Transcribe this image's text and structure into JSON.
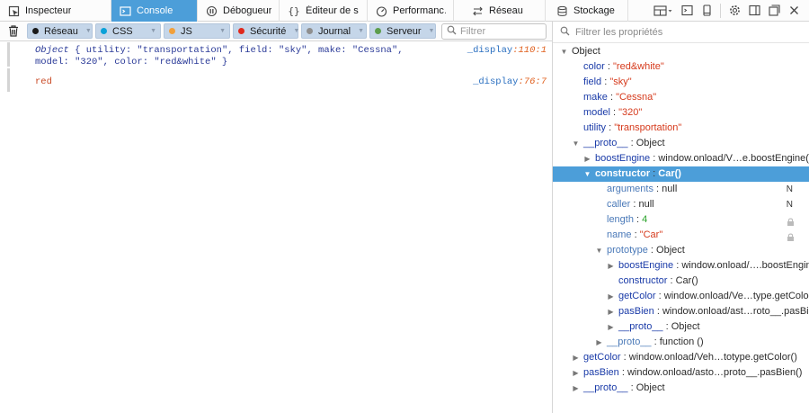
{
  "toolbar": {
    "tabs": [
      {
        "label": "Inspecteur",
        "icon": "inspector-icon"
      },
      {
        "label": "Console",
        "icon": "console-icon"
      },
      {
        "label": "Débogueur",
        "icon": "debugger-icon"
      },
      {
        "label": "Éditeur de s…",
        "icon": "style-editor-icon"
      },
      {
        "label": "Performanc…",
        "icon": "performance-icon"
      },
      {
        "label": "Réseau",
        "icon": "network-icon"
      },
      {
        "label": "Stockage",
        "icon": "storage-icon"
      }
    ],
    "selected_tab": "Console",
    "right_icons": [
      "layout-dock-icon",
      "split-console-icon",
      "responsive-mode-icon",
      "settings-gear-icon",
      "dock-side-icon",
      "dock-window-icon",
      "close-icon"
    ]
  },
  "filterbar": {
    "clear_icon": "trash-icon",
    "filters": [
      {
        "label": "Réseau",
        "color": "#1a1a1a"
      },
      {
        "label": "CSS",
        "color": "#0aa1d8"
      },
      {
        "label": "JS",
        "color": "#f2a03a"
      },
      {
        "label": "Sécurité",
        "color": "#e0281c"
      },
      {
        "label": "Journal",
        "color": "#8f8f8f"
      },
      {
        "label": "Serveur",
        "color": "#5c9d4c"
      }
    ],
    "search_placeholder": "Filtrer"
  },
  "console": {
    "messages": [
      {
        "object_keyword": "Object",
        "text": " { utility: \"transportation\", field: \"sky\", make: \"Cessna\", model: \"320\", color: \"red&white\" }",
        "source": "_display",
        "line": ":110:1"
      },
      {
        "text": "red",
        "source": "_display",
        "line": ":76:7"
      }
    ]
  },
  "sidebar": {
    "search_placeholder": "Filtrer les propriétés",
    "rows": [
      {
        "indent": 0,
        "twisty": "open",
        "name": "Object",
        "name_style": "plain",
        "sep": "",
        "value": "",
        "value_style": ""
      },
      {
        "indent": 1,
        "twisty": "none",
        "name": "color",
        "name_style": "prop",
        "sep": " : ",
        "value": "\"red&white\"",
        "value_style": "str"
      },
      {
        "indent": 1,
        "twisty": "none",
        "name": "field",
        "name_style": "prop",
        "sep": " : ",
        "value": "\"sky\"",
        "value_style": "str"
      },
      {
        "indent": 1,
        "twisty": "none",
        "name": "make",
        "name_style": "prop",
        "sep": " : ",
        "value": "\"Cessna\"",
        "value_style": "str"
      },
      {
        "indent": 1,
        "twisty": "none",
        "name": "model",
        "name_style": "prop",
        "sep": " : ",
        "value": "\"320\"",
        "value_style": "str"
      },
      {
        "indent": 1,
        "twisty": "none",
        "name": "utility",
        "name_style": "prop",
        "sep": " : ",
        "value": "\"transportation\"",
        "value_style": "str"
      },
      {
        "indent": 1,
        "twisty": "open",
        "name": "__proto__",
        "name_style": "prop",
        "sep": " : ",
        "value": "Object",
        "value_style": "plain"
      },
      {
        "indent": 2,
        "twisty": "closed",
        "name": "boostEngine",
        "name_style": "prop",
        "sep": " : ",
        "value": "window.onload/V…e.boostEngine()",
        "value_style": "plain"
      },
      {
        "indent": 2,
        "twisty": "open",
        "name": "constructor",
        "name_style": "prop",
        "sep": " : ",
        "value": "Car()",
        "value_style": "plain",
        "selected": true
      },
      {
        "indent": 3,
        "twisty": "none",
        "name": "arguments",
        "name_style": "dim",
        "sep": " : ",
        "value": "null",
        "value_style": "plain",
        "flag": "N"
      },
      {
        "indent": 3,
        "twisty": "none",
        "name": "caller",
        "name_style": "dim",
        "sep": " : ",
        "value": "null",
        "value_style": "plain",
        "flag": "N"
      },
      {
        "indent": 3,
        "twisty": "none",
        "name": "length",
        "name_style": "dim",
        "sep": " : ",
        "value": "4",
        "value_style": "num",
        "lock": true
      },
      {
        "indent": 3,
        "twisty": "none",
        "name": "name",
        "name_style": "dim",
        "sep": " : ",
        "value": "\"Car\"",
        "value_style": "str",
        "lock": true
      },
      {
        "indent": 3,
        "twisty": "open",
        "name": "prototype",
        "name_style": "dim",
        "sep": " : ",
        "value": "Object",
        "value_style": "plain"
      },
      {
        "indent": 4,
        "twisty": "closed",
        "name": "boostEngine",
        "name_style": "prop",
        "sep": " : ",
        "value": "window.onload/….boostEngine()",
        "value_style": "plain"
      },
      {
        "indent": 4,
        "twisty": "none",
        "name": "constructor",
        "name_style": "prop",
        "sep": " : ",
        "value": "Car()",
        "value_style": "plain"
      },
      {
        "indent": 4,
        "twisty": "closed",
        "name": "getColor",
        "name_style": "prop",
        "sep": " : ",
        "value": "window.onload/Ve…type.getColor()",
        "value_style": "plain"
      },
      {
        "indent": 4,
        "twisty": "closed",
        "name": "pasBien",
        "name_style": "prop",
        "sep": " : ",
        "value": "window.onload/ast…roto__.pasBien()",
        "value_style": "plain"
      },
      {
        "indent": 4,
        "twisty": "closed",
        "name": "__proto__",
        "name_style": "prop",
        "sep": " : ",
        "value": "Object",
        "value_style": "plain"
      },
      {
        "indent": 3,
        "twisty": "closed",
        "name": "__proto__",
        "name_style": "dim",
        "sep": " : ",
        "value": "function ()",
        "value_style": "plain"
      },
      {
        "indent": 1,
        "twisty": "closed",
        "name": "getColor",
        "name_style": "prop",
        "sep": " : ",
        "value": "window.onload/Veh…totype.getColor()",
        "value_style": "plain"
      },
      {
        "indent": 1,
        "twisty": "closed",
        "name": "pasBien",
        "name_style": "prop",
        "sep": " : ",
        "value": "window.onload/asto…proto__.pasBien()",
        "value_style": "plain"
      },
      {
        "indent": 1,
        "twisty": "closed",
        "name": "__proto__",
        "name_style": "prop",
        "sep": " : ",
        "value": "Object",
        "value_style": "plain"
      }
    ]
  }
}
